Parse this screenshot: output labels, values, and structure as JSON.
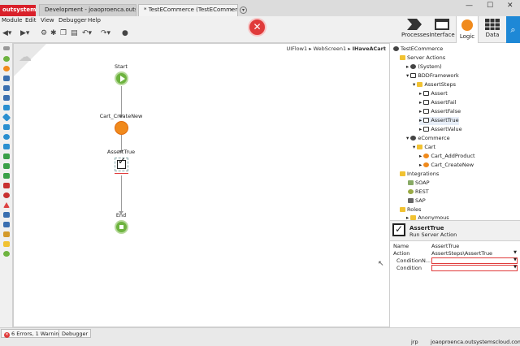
{
  "tabs": {
    "brand": "outsystems",
    "dev": "Development - joaoproenca.outs...",
    "active": "* TestECommerce (TestECommerce)",
    "close": "×",
    "new": "▾"
  },
  "window": {
    "min": "—",
    "max": "☐",
    "close": "✕"
  },
  "menu": {
    "module": "Module",
    "edit": "Edit",
    "view": "View",
    "debugger": "Debugger",
    "help": "Help"
  },
  "toolbar": {
    "error_symbol": "✕"
  },
  "right_tabs": {
    "processes": "Processes",
    "interface": "Interface",
    "logic": "Logic",
    "data": "Data",
    "search": "⌕"
  },
  "canvas": {
    "breadcrumb_1": "UIFlow1",
    "breadcrumb_2": "WebScreen1",
    "breadcrumb_3": "IHaveACart",
    "sep": "▸",
    "nodes": {
      "start": "Start",
      "action1": "Cart_CreateNew",
      "action2": "AssertTrue",
      "end": "End"
    }
  },
  "tree": {
    "root": "TestECommerce",
    "server_actions": "Server Actions",
    "system": "(System)",
    "bdd": "BDDFramework",
    "assert_steps": "AssertSteps",
    "assert": "Assert",
    "assert_fail": "AssertFail",
    "assert_false": "AssertFalse",
    "assert_true": "AssertTrue",
    "assert_value": "AssertValue",
    "ecommerce": "eCommerce",
    "cart": "Cart",
    "cart_add": "Cart_AddProduct",
    "cart_create": "Cart_CreateNew",
    "integrations": "Integrations",
    "soap": "SOAP",
    "rest": "REST",
    "sap": "SAP",
    "roles": "Roles",
    "anonymous": "Anonymous"
  },
  "props": {
    "title": "AssertTrue",
    "subtitle": "Run Server Action",
    "name_label": "Name",
    "name_value": "AssertTrue",
    "action_label": "Action",
    "action_value": "AssertSteps\\AssertTrue",
    "cond_msg_label": "ConditionN...",
    "cond_label": "Condition",
    "dd": "▼"
  },
  "status": {
    "errors": "6 Errors, 1 Warning",
    "debugger": "Debugger",
    "user": "jrp",
    "server": "joaoproenca.outsystemscloud.com"
  },
  "colors": {
    "brand": "#d9202a",
    "start_end": "#6db33f",
    "action": "#f08a1c",
    "error": "#e03a3a",
    "search": "#1e88d6"
  }
}
